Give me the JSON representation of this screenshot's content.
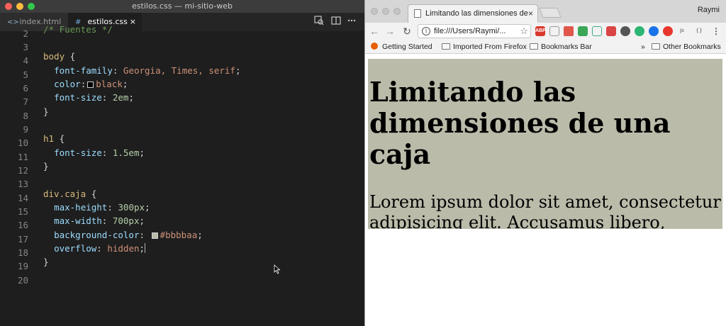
{
  "editor": {
    "window_title": "estilos.css — mi-sitio-web",
    "tabs": [
      {
        "icon": "<>",
        "label": "index.html"
      },
      {
        "icon": "#",
        "label": "estilos.css",
        "close": "×"
      }
    ],
    "line_numbers": [
      "2",
      "3",
      "4",
      "5",
      "6",
      "7",
      "8",
      "9",
      "10",
      "11",
      "12",
      "13",
      "14",
      "15",
      "16",
      "17",
      "18",
      "19",
      "20"
    ],
    "code": {
      "l1": "/* Fuentes */",
      "body_sel": "body",
      "open_brace": " {",
      "close_brace": "}",
      "ff_prop": "font-family",
      "ff_val": "Georgia, Times, serif",
      "color_prop": "color",
      "color_val": "black",
      "fs_prop": "font-size",
      "fs_val": "2em",
      "h1_sel": "h1",
      "fs2_val": "1.5em",
      "div_sel": "div.caja",
      "mh_prop": "max-height",
      "mh_val": "300px",
      "mw_prop": "max-width",
      "mw_val": "700px",
      "bg_prop": "background-color",
      "bg_val": "#bbbbaa",
      "ov_prop": "overflow",
      "ov_val": "hidden"
    },
    "colors": {
      "black_swatch": "#000000",
      "bg_swatch": "#bbbbaa"
    }
  },
  "browser": {
    "tab_title": "Limitando las dimensiones de",
    "tab_close": "×",
    "profile": "Raymi",
    "address": "file:///Users/Raymi/...",
    "bookmarks": [
      "Getting Started",
      "Imported From Firefox",
      "Bookmarks Bar",
      "»",
      "Other Bookmarks"
    ],
    "extensions": [
      "ABP",
      "",
      "",
      "",
      "",
      "",
      "",
      "",
      "",
      "",
      "",
      ""
    ],
    "page": {
      "heading": "Limitando las dimensiones de una caja",
      "paragraph": "Lorem ipsum dolor sit amet, consectetur adipisicing elit. Accusamus libero, officiis esse. Quia qui, et, repellendus tenetur veritatis, quaerat sed error sint, dolore dicta"
    }
  }
}
